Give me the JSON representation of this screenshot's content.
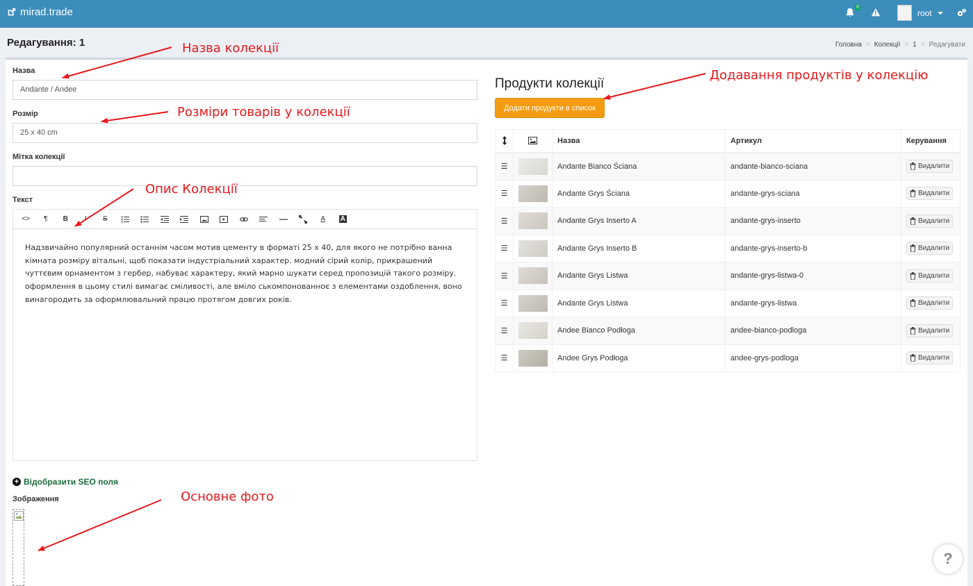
{
  "app": {
    "brand": "mirad.trade",
    "notifications_count": "0",
    "user_name": "root"
  },
  "page": {
    "title": "Редагування: 1",
    "breadcrumb": [
      "Головна",
      "Колекції",
      "1",
      "Редагувати"
    ]
  },
  "form": {
    "name_label": "Назва",
    "name_value": "Andante / Andee",
    "size_label": "Розмір",
    "size_value": "25 x 40  cm",
    "tag_label": "Мітка колекції",
    "tag_value": "",
    "text_label": "Текст",
    "editor_tools": [
      "code-view",
      "paragraph",
      "bold",
      "italic",
      "strikethrough",
      "bullet-list",
      "numbered-list",
      "outdent",
      "indent",
      "image",
      "video",
      "link",
      "align",
      "horizontal-rule",
      "fullscreen",
      "font-color",
      "background-color"
    ],
    "text_value": "Надзвичайно популярний останнім часом мотив цементу в форматі 25 х 40, для якого не потрібно ванна кімната розміру вітальні, щоб показати індустріальний характер. модний сірий колір, прикрашений чуттєвим орнаментом з гербер, набуває характеру, який марно шукати серед пропозицій такого розміру. оформлення в цьому стилі вимагає сміливості, але вміло ськомпонованнoє з елементами оздоблення, воно винагородить за оформлювальний працю протягом довгих років.",
    "seo_toggle": "Відобразити SEO поля",
    "image_label": "Зображення"
  },
  "products": {
    "title": "Продукти колекції",
    "add_button": "Додати продукти в список",
    "columns": {
      "name": "Назва",
      "sku": "Артикул",
      "actions": "Керування"
    },
    "delete_label": "Видалити",
    "rows": [
      {
        "name": "Andante Bianco Ściana",
        "sku": "andante-bianco-sciana",
        "thumb": "#e6e4de"
      },
      {
        "name": "Andante Grys Ściana",
        "sku": "andante-grys-sciana",
        "thumb": "#c9c4bb"
      },
      {
        "name": "Andante Grys Inserto A",
        "sku": "andante-grys-inserto",
        "thumb": "#d6d2c9"
      },
      {
        "name": "Andante Grys Inserto B",
        "sku": "andante-grys-inserto-b",
        "thumb": "#dcd9d2"
      },
      {
        "name": "Andante Grys Listwa",
        "sku": "andante-grys-listwa-0",
        "thumb": "#d3cfc6"
      },
      {
        "name": "Andante Grys Listwa",
        "sku": "andante-grys-listwa",
        "thumb": "#cac5bb"
      },
      {
        "name": "Andee Bianco Podłoga",
        "sku": "andee-bianco-podloga",
        "thumb": "#e2dfd8"
      },
      {
        "name": "Andee Grys Podłoga",
        "sku": "andee-grys-podloga",
        "thumb": "#bdb9ae"
      }
    ]
  },
  "annotations": {
    "name": "Назва колекції",
    "size": "Розміри товарів у колекції",
    "description": "Опис Колекції",
    "main_photo": "Основне фото",
    "add_products": "Додавання продуктів у колекцію"
  },
  "help": "?",
  "colors": {
    "header": "#3c8dbc",
    "accent_button": "#f39c12",
    "annotation": "#e8171b",
    "seo_link": "#1b6a3a"
  }
}
